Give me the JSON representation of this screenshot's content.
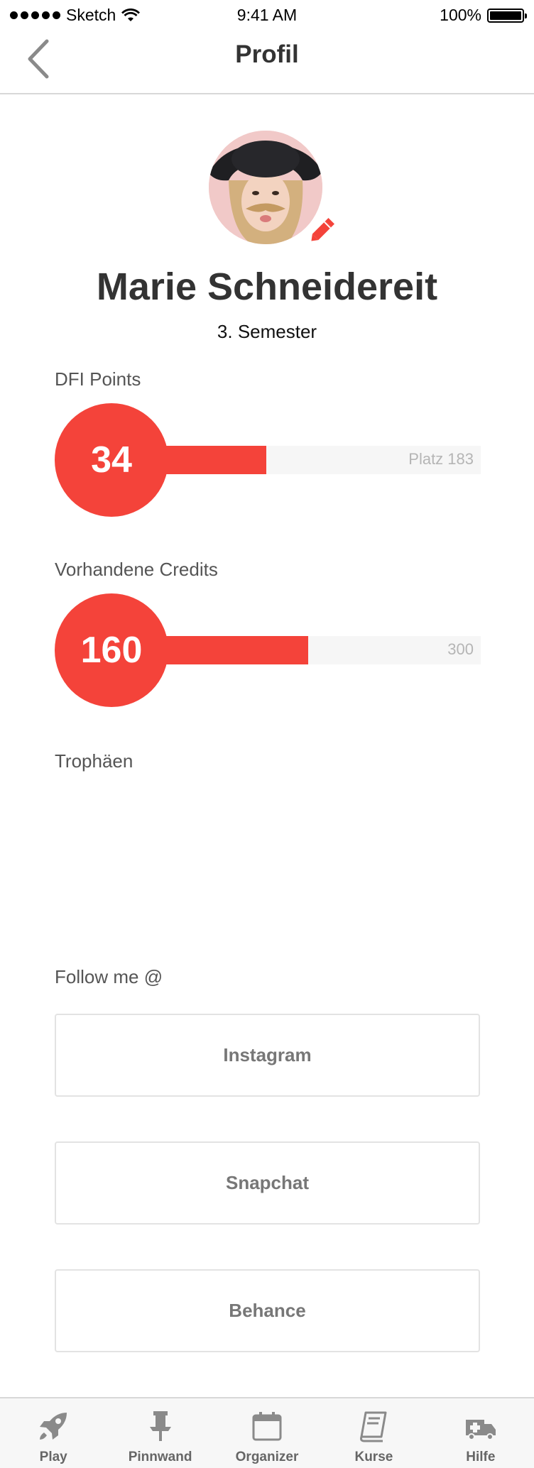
{
  "status_bar": {
    "carrier": "Sketch",
    "time": "9:41 AM",
    "battery": "100%"
  },
  "nav": {
    "title": "Profil",
    "back_icon": "chevron-left-icon"
  },
  "profile": {
    "name": "Marie Schneidereit",
    "subtitle": "3. Semester",
    "edit_icon": "pencil-icon",
    "accent_color": "#f4433a"
  },
  "dfi_points": {
    "label": "DFI Points",
    "value": "34",
    "rank_text": "Platz 183",
    "progress_fraction": 0.42
  },
  "credits": {
    "label": "Vorhandene Credits",
    "value": "160",
    "max_text": "300",
    "progress_fraction": 0.533
  },
  "trophies": {
    "label": "Trophäen"
  },
  "follow": {
    "label": "Follow me @",
    "buttons": [
      "Instagram",
      "Snapchat",
      "Behance"
    ]
  },
  "tabs": [
    {
      "label": "Play",
      "icon": "rocket-icon"
    },
    {
      "label": "Pinnwand",
      "icon": "pin-icon"
    },
    {
      "label": "Organizer",
      "icon": "calendar-icon"
    },
    {
      "label": "Kurse",
      "icon": "book-icon"
    },
    {
      "label": "Hilfe",
      "icon": "ambulance-icon"
    }
  ]
}
